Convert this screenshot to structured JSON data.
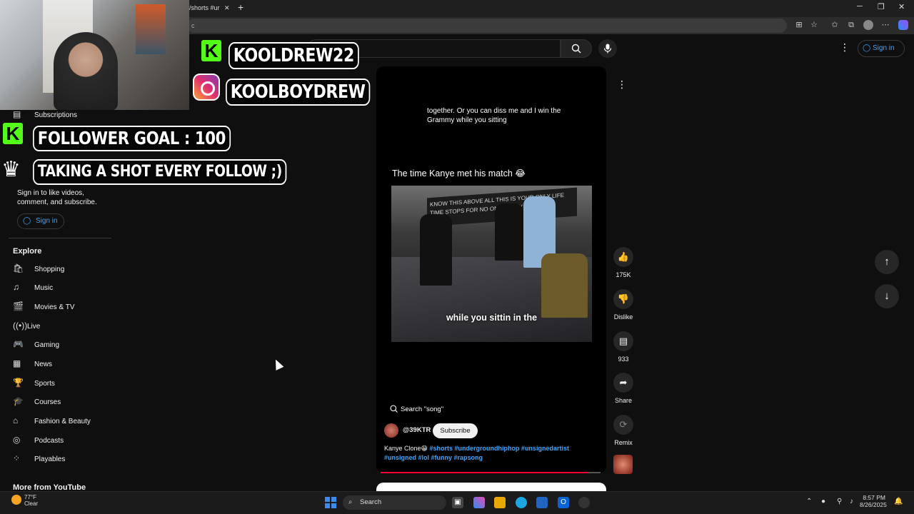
{
  "browser": {
    "tab_title": "/shorts #ur",
    "new_tab": "+",
    "window_controls": [
      "─",
      "❐",
      "✕"
    ],
    "address": "c"
  },
  "header": {
    "search_placeholder": "h",
    "signin_label": "Sign in"
  },
  "overlay": {
    "kick_name": "KOOLDREW22",
    "ig_name": "KOOLBOYDREW",
    "goal": "FOLLOWER GOAL : 100",
    "shot": "TAKING A SHOT EVERY FOLLOW ;)"
  },
  "sidebar": {
    "subscriptions": "Subscriptions",
    "signin_prompt": "Sign in to like videos, comment, and subscribe.",
    "signin_button": "Sign in",
    "explore_heading": "Explore",
    "explore_items": [
      {
        "label": "Shopping",
        "icon": "shopping-bag-icon"
      },
      {
        "label": "Music",
        "icon": "music-note-icon"
      },
      {
        "label": "Movies & TV",
        "icon": "clapperboard-icon"
      },
      {
        "label": "Live",
        "icon": "live-icon"
      },
      {
        "label": "Gaming",
        "icon": "gamepad-icon"
      },
      {
        "label": "News",
        "icon": "newspaper-icon"
      },
      {
        "label": "Sports",
        "icon": "trophy-icon"
      },
      {
        "label": "Courses",
        "icon": "graduation-cap-icon"
      },
      {
        "label": "Fashion & Beauty",
        "icon": "hanger-icon"
      },
      {
        "label": "Podcasts",
        "icon": "podcast-icon"
      },
      {
        "label": "Playables",
        "icon": "playables-icon"
      }
    ],
    "more_heading": "More from YouTube"
  },
  "short": {
    "lyric_text": "together. Or you can diss me and I win the Grammy while you sitting",
    "caption": "The time Kanye met his match 😂",
    "video_banner": "KNOW THIS ABOVE ALL THIS IS YOUR ONLY LIFE TIME STOPS FOR NO ONE TODAY",
    "video_subtitle": "while you sittin in the",
    "song_label": "Search \"song\"",
    "channel": "@39KTR",
    "subscribe_label": "Subscribe",
    "description_title": "Kanye Clone😁",
    "description_tags": "#shorts #undergroundhiphop #unsignedartist #unsigned #lol #funny #rapsong",
    "progress": 0.94
  },
  "actions": {
    "like_count": "175K",
    "dislike_label": "Dislike",
    "comment_count": "933",
    "share_label": "Share",
    "remix_label": "Remix"
  },
  "taskbar": {
    "temperature": "77°F",
    "condition": "Clear",
    "search_label": "Search",
    "time": "8:57 PM",
    "date": "8/26/2025"
  },
  "colors": {
    "background": "#0f0f0f",
    "link_blue": "#3ea6ff",
    "kick_green": "#53fc18",
    "progress_red": "#ff0033"
  }
}
